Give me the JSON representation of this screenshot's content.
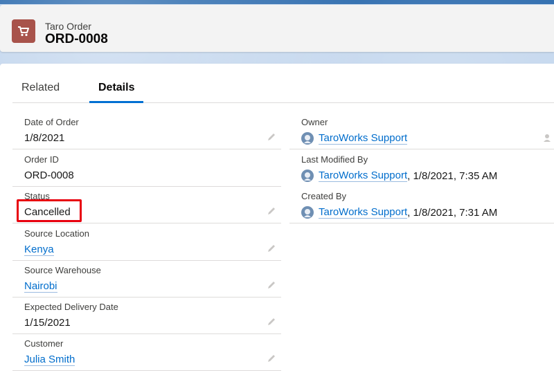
{
  "header": {
    "object_type": "Taro Order",
    "record_name": "ORD-0008",
    "icon": "shopping-cart-icon"
  },
  "tabs": [
    {
      "label": "Related",
      "active": false
    },
    {
      "label": "Details",
      "active": true
    }
  ],
  "left_fields": [
    {
      "label": "Date of Order",
      "value": "1/8/2021",
      "is_link": false,
      "editable": true
    },
    {
      "label": "Order ID",
      "value": "ORD-0008",
      "is_link": false,
      "editable": false
    },
    {
      "label": "Status",
      "value": "Cancelled",
      "is_link": false,
      "editable": true
    },
    {
      "label": "Source Location",
      "value": "Kenya",
      "is_link": true,
      "editable": true
    },
    {
      "label": "Source Warehouse",
      "value": "Nairobi",
      "is_link": true,
      "editable": true
    },
    {
      "label": "Expected Delivery Date",
      "value": "1/15/2021",
      "is_link": false,
      "editable": true
    },
    {
      "label": "Customer",
      "value": "Julia Smith",
      "is_link": true,
      "editable": true
    }
  ],
  "right_fields": [
    {
      "label": "Owner",
      "user": "TaroWorks Support",
      "suffix": ""
    },
    {
      "label": "Last Modified By",
      "user": "TaroWorks Support",
      "suffix": ", 1/8/2021, 7:35 AM"
    },
    {
      "label": "Created By",
      "user": "TaroWorks Support",
      "suffix": ", 1/8/2021, 7:31 AM"
    }
  ],
  "colors": {
    "accent": "#0070d2",
    "link": "#006dcc",
    "object_icon": "#a8534b",
    "highlight": "#e8000e"
  }
}
